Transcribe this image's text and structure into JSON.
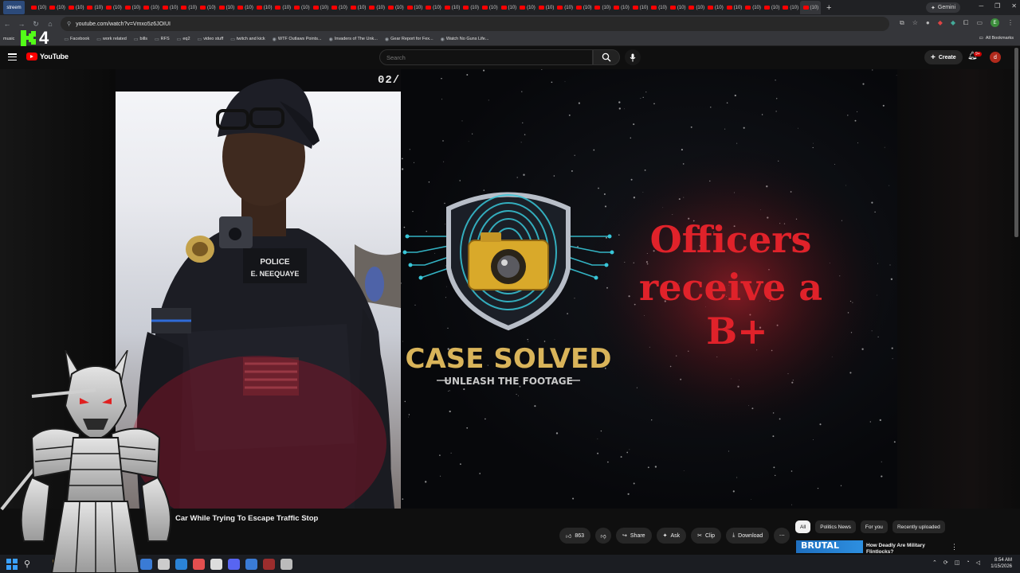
{
  "browser": {
    "first_tab_label": "streem",
    "tab_label": "(10)",
    "tab_count": 42,
    "gemini_label": "Gemini",
    "url": "youtube.com/watch?v=Vmxo5z6JOIUI",
    "profile_initial": "E",
    "bookmarks": [
      {
        "icon": "folder-icon",
        "label": "Facebook"
      },
      {
        "icon": "folder-icon",
        "label": "work related"
      },
      {
        "icon": "folder-icon",
        "label": "bills"
      },
      {
        "icon": "folder-icon",
        "label": "RFS"
      },
      {
        "icon": "folder-icon",
        "label": "eq2"
      },
      {
        "icon": "folder-icon",
        "label": "video stuff"
      },
      {
        "icon": "folder-icon",
        "label": "twitch and kick"
      },
      {
        "icon": "page-icon",
        "label": "WTF Outlaws Points..."
      },
      {
        "icon": "page-icon",
        "label": "Invaders of The Unk..."
      },
      {
        "icon": "page-icon",
        "label": "Gear Report for Fex..."
      },
      {
        "icon": "page-icon",
        "label": "Watch No Guns Life..."
      }
    ],
    "all_bookmarks_label": "All Bookmarks",
    "bookmark_left_label": "music"
  },
  "youtube": {
    "logo_text": "YouTube",
    "search_placeholder": "Search",
    "create_label": "Create",
    "notification_badge": "9+",
    "avatar_initial": "d"
  },
  "video": {
    "timestamp": "02/",
    "badge_police": "POLICE",
    "badge_name": "E. NEEQUAYE",
    "logo_title": "CASE SOLVED",
    "logo_subtitle": "UNLEASH THE FOOTAGE",
    "overlay_lines": [
      "Officers",
      "receive a",
      "B+"
    ],
    "stream_logo": "4",
    "title": "Car While Trying To Escape Traffic Stop"
  },
  "actions": {
    "likes": "863",
    "share": "Share",
    "ask": "Ask",
    "clip": "Clip",
    "download": "Download"
  },
  "chips": [
    "All",
    "Politics News",
    "For you",
    "Recently uploaded"
  ],
  "suggestion": {
    "thumb_text": "BRUTAL",
    "title": "How Deadly Are Military Flintlocks?"
  },
  "taskbar": {
    "time": "8:54 AM",
    "date": "1/15/2026"
  },
  "colors": {
    "youtube_red": "#ff0000",
    "overlay_red": "#e0222a",
    "case_solved_gold": "#d9b45a",
    "fingerprint_cyan": "#38c6d8"
  }
}
